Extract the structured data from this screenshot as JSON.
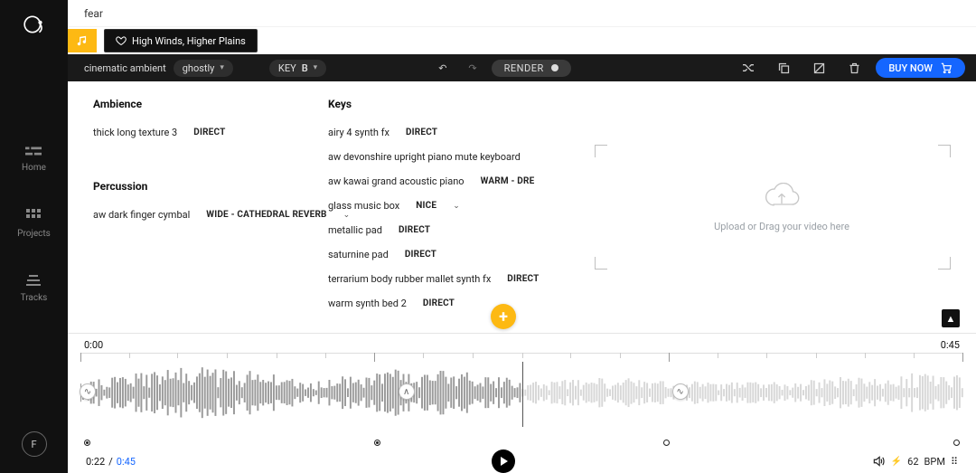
{
  "search_query": "fear",
  "tabs": {
    "saved_track": "High Winds, Higher Plains"
  },
  "toolbar": {
    "style": "cinematic ambient",
    "mood": "ghostly",
    "key_label": "KEY",
    "key_value": "B",
    "render_label": "RENDER",
    "buy_label": "BUY NOW"
  },
  "sidebar": {
    "items": [
      {
        "label": "Home"
      },
      {
        "label": "Projects"
      },
      {
        "label": "Tracks"
      }
    ],
    "avatar_initial": "F"
  },
  "instruments": {
    "ambience_header": "Ambience",
    "ambience": [
      {
        "name": "thick long texture 3",
        "preset": "DIRECT"
      }
    ],
    "percussion_header": "Percussion",
    "percussion": [
      {
        "name": "aw dark finger cymbal",
        "preset": "WIDE - CATHEDRAL REVERB"
      }
    ],
    "keys_header": "Keys",
    "keys": [
      {
        "name": "airy 4 synth fx",
        "preset": "DIRECT"
      },
      {
        "name": "aw devonshire upright piano mute keyboard",
        "preset": ""
      },
      {
        "name": "aw kawai grand acoustic piano",
        "preset": "WARM - DRE"
      },
      {
        "name": "glass music box",
        "preset": "NICE"
      },
      {
        "name": "metallic pad",
        "preset": "DIRECT"
      },
      {
        "name": "saturnine pad",
        "preset": "DIRECT"
      },
      {
        "name": "terrarium body rubber mallet synth fx",
        "preset": "DIRECT"
      },
      {
        "name": "warm synth bed 2",
        "preset": "DIRECT"
      }
    ]
  },
  "upload_hint": "Upload or Drag your video here",
  "timeline": {
    "start": "0:00",
    "end": "0:45",
    "playhead_pct": 50,
    "current": "0:22",
    "total": "0:45",
    "bpm_label": "BPM",
    "bpm_value": "62"
  }
}
